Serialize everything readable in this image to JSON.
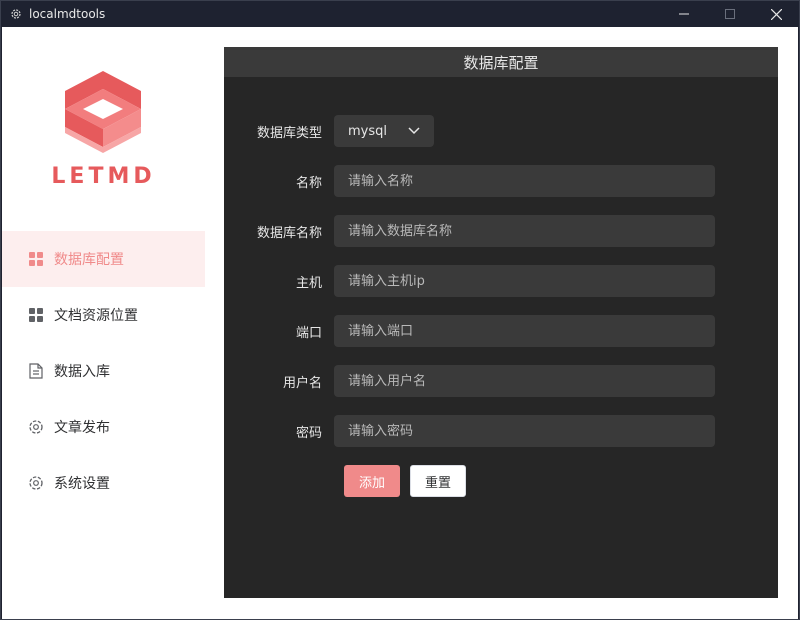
{
  "window": {
    "title": "localmdtools"
  },
  "logo": {
    "text": "LETMD"
  },
  "colors": {
    "brand": "#e65a5c",
    "accent": "#f08a8a",
    "active_bg": "#fdeeee",
    "panel": "#262626"
  },
  "sidebar": {
    "items": [
      {
        "label": "数据库配置",
        "icon": "grid-icon",
        "active": true
      },
      {
        "label": "文档资源位置",
        "icon": "grid-icon",
        "active": false
      },
      {
        "label": "数据入库",
        "icon": "document-icon",
        "active": false
      },
      {
        "label": "文章发布",
        "icon": "gear-icon",
        "active": false
      },
      {
        "label": "系统设置",
        "icon": "gear-icon",
        "active": false
      }
    ]
  },
  "main": {
    "title": "数据库配置",
    "form": {
      "db_type": {
        "label": "数据库类型",
        "value": "mysql"
      },
      "name": {
        "label": "名称",
        "placeholder": "请输入名称"
      },
      "db_name": {
        "label": "数据库名称",
        "placeholder": "请输入数据库名称"
      },
      "host": {
        "label": "主机",
        "placeholder": "请输入主机ip"
      },
      "port": {
        "label": "端口",
        "placeholder": "请输入端口"
      },
      "username": {
        "label": "用户名",
        "placeholder": "请输入用户名"
      },
      "password": {
        "label": "密码",
        "placeholder": "请输入密码"
      }
    },
    "buttons": {
      "add": "添加",
      "reset": "重置"
    }
  }
}
